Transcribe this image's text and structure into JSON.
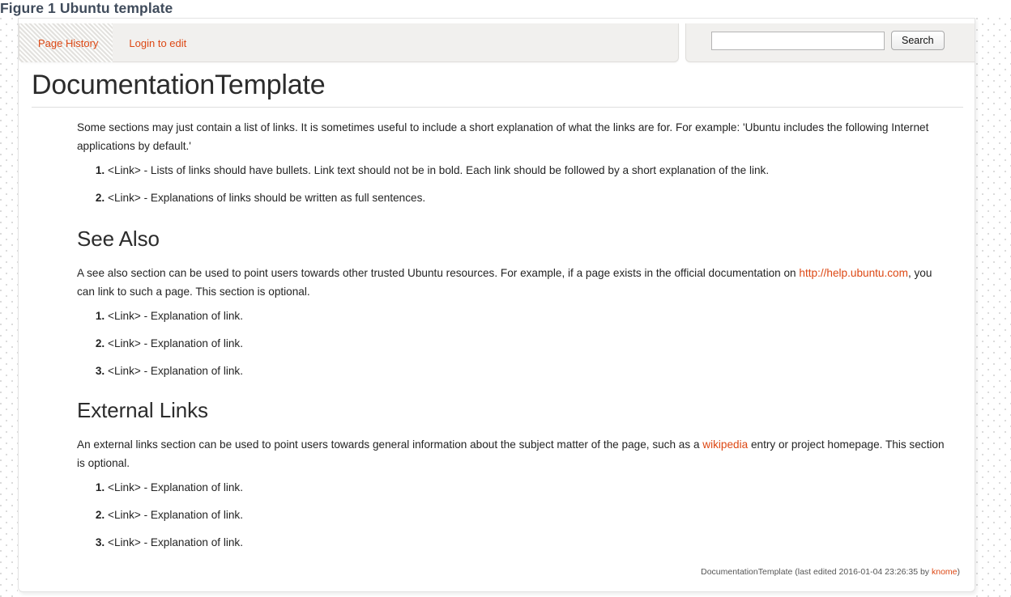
{
  "figure": {
    "caption": "Figure 1 Ubuntu template",
    "caption_color": "#3f4b5b"
  },
  "theme": {
    "link_color": "#dd4814",
    "text_color": "#242424",
    "heading_color": "#2c2c2c",
    "panel_bg": "#f1f0ee",
    "panel_border": "#e0dedb"
  },
  "nav": {
    "links": [
      {
        "label": "Page History",
        "active": true
      },
      {
        "label": "Login to edit",
        "active": false
      }
    ]
  },
  "search": {
    "value": "",
    "placeholder": "",
    "button_label": "Search"
  },
  "page": {
    "title": "DocumentationTemplate",
    "intro_paragraph": "Some sections may just contain a list of links. It is sometimes useful to include a short explanation of what the links are for. For example: 'Ubuntu includes the following Internet applications by default.'",
    "intro_list": [
      "<Link> - Lists of links should have bullets. Link text should not be in bold. Each link should be followed by a short explanation of the link.",
      "<Link> - Explanations of links should be written as full sentences."
    ],
    "sections": [
      {
        "heading": "See Also",
        "paragraph_before_link": "A see also section can be used to point users towards other trusted Ubuntu resources. For example, if a page exists in the official documentation on ",
        "link_text": "http://help.ubuntu.com",
        "paragraph_after_link": ", you can link to such a page. This section is optional.",
        "list": [
          "<Link> - Explanation of link.",
          "<Link> - Explanation of link.",
          "<Link> - Explanation of link."
        ]
      },
      {
        "heading": "External Links",
        "paragraph_before_link": "An external links section can be used to point users towards general information about the subject matter of the page, such as a ",
        "link_text": "wikipedia",
        "paragraph_after_link": " entry or project homepage. This section is optional.",
        "list": [
          "<Link> - Explanation of link.",
          "<Link> - Explanation of link.",
          "<Link> - Explanation of link."
        ]
      }
    ],
    "footer": {
      "page_name": "DocumentationTemplate",
      "edited_prefix": " (last edited ",
      "timestamp": "2016-01-04 23:26:35",
      "by_text": " by ",
      "editor": "knome",
      "suffix": ")"
    }
  }
}
